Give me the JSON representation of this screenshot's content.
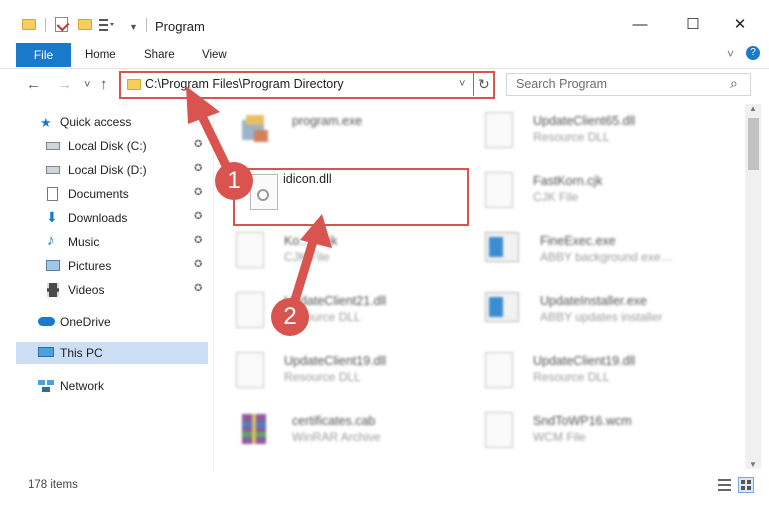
{
  "window": {
    "title": "Program",
    "minimize": "—",
    "maximize": "☐",
    "close": "✕"
  },
  "ribbon": {
    "tabs": [
      "File",
      "Home",
      "Share",
      "View"
    ],
    "help_icon": "?",
    "collapse_icon": "˅"
  },
  "nav": {
    "back": "←",
    "forward": "→",
    "recent": "˅",
    "up": "↑",
    "address": "C:\\Program Files\\Program Directory",
    "address_dropdown": "˅",
    "refresh": "↻",
    "search_placeholder": "Search Program",
    "search_icon": "⌕"
  },
  "sidebar": {
    "quick_access": "Quick access",
    "items": [
      {
        "label": "Local Disk (C:)",
        "icon": "drive-icon",
        "pinned": true
      },
      {
        "label": "Local Disk (D:)",
        "icon": "drive-icon",
        "pinned": true
      },
      {
        "label": "Documents",
        "icon": "documents-icon",
        "pinned": true
      },
      {
        "label": "Downloads",
        "icon": "downloads-icon",
        "pinned": true
      },
      {
        "label": "Music",
        "icon": "music-icon",
        "pinned": true
      },
      {
        "label": "Pictures",
        "icon": "pictures-icon",
        "pinned": true
      },
      {
        "label": "Videos",
        "icon": "videos-icon",
        "pinned": true
      }
    ],
    "onedrive": "OneDrive",
    "this_pc": "This PC",
    "network": "Network",
    "pin_glyph": "📌"
  },
  "files": [
    {
      "name": "program.exe",
      "type": "",
      "icon": "program-icon"
    },
    {
      "name": "UpdateClient65.dll",
      "type": "Resource DLL",
      "icon": "dll-icon"
    },
    {
      "name": "idicon.dll",
      "type": "",
      "icon": "dll-icon"
    },
    {
      "name": "FastKorn.cjk",
      "type": "CJK File",
      "icon": "file-icon"
    },
    {
      "name": "Ko…n.cjk",
      "type": "CJK File",
      "icon": "file-icon"
    },
    {
      "name": "FineExec.exe",
      "type": "ABBY background exe…",
      "icon": "app-icon"
    },
    {
      "name": "UpdateClient21.dll",
      "type": "Resource DLL",
      "icon": "dll-icon"
    },
    {
      "name": "UpdateInstaller.exe",
      "type": "ABBY updates installer",
      "icon": "app-icon"
    },
    {
      "name": "UpdateClient19.dll",
      "type": "Resource DLL",
      "icon": "dll-icon"
    },
    {
      "name": "UpdateClient19.dll",
      "type": "Resource DLL",
      "icon": "dll-icon"
    },
    {
      "name": "certificates.cab",
      "type": "WinRAR Archive",
      "icon": "archive-icon"
    },
    {
      "name": "SndToWP16.wcm",
      "type": "WCM File",
      "icon": "file-icon"
    }
  ],
  "annotations": {
    "step1": "1",
    "step2": "2"
  },
  "status": {
    "item_count": "178 items"
  },
  "colors": {
    "accent": "#1979ca",
    "highlight": "#d9534f",
    "selection": "#ccdef4"
  }
}
